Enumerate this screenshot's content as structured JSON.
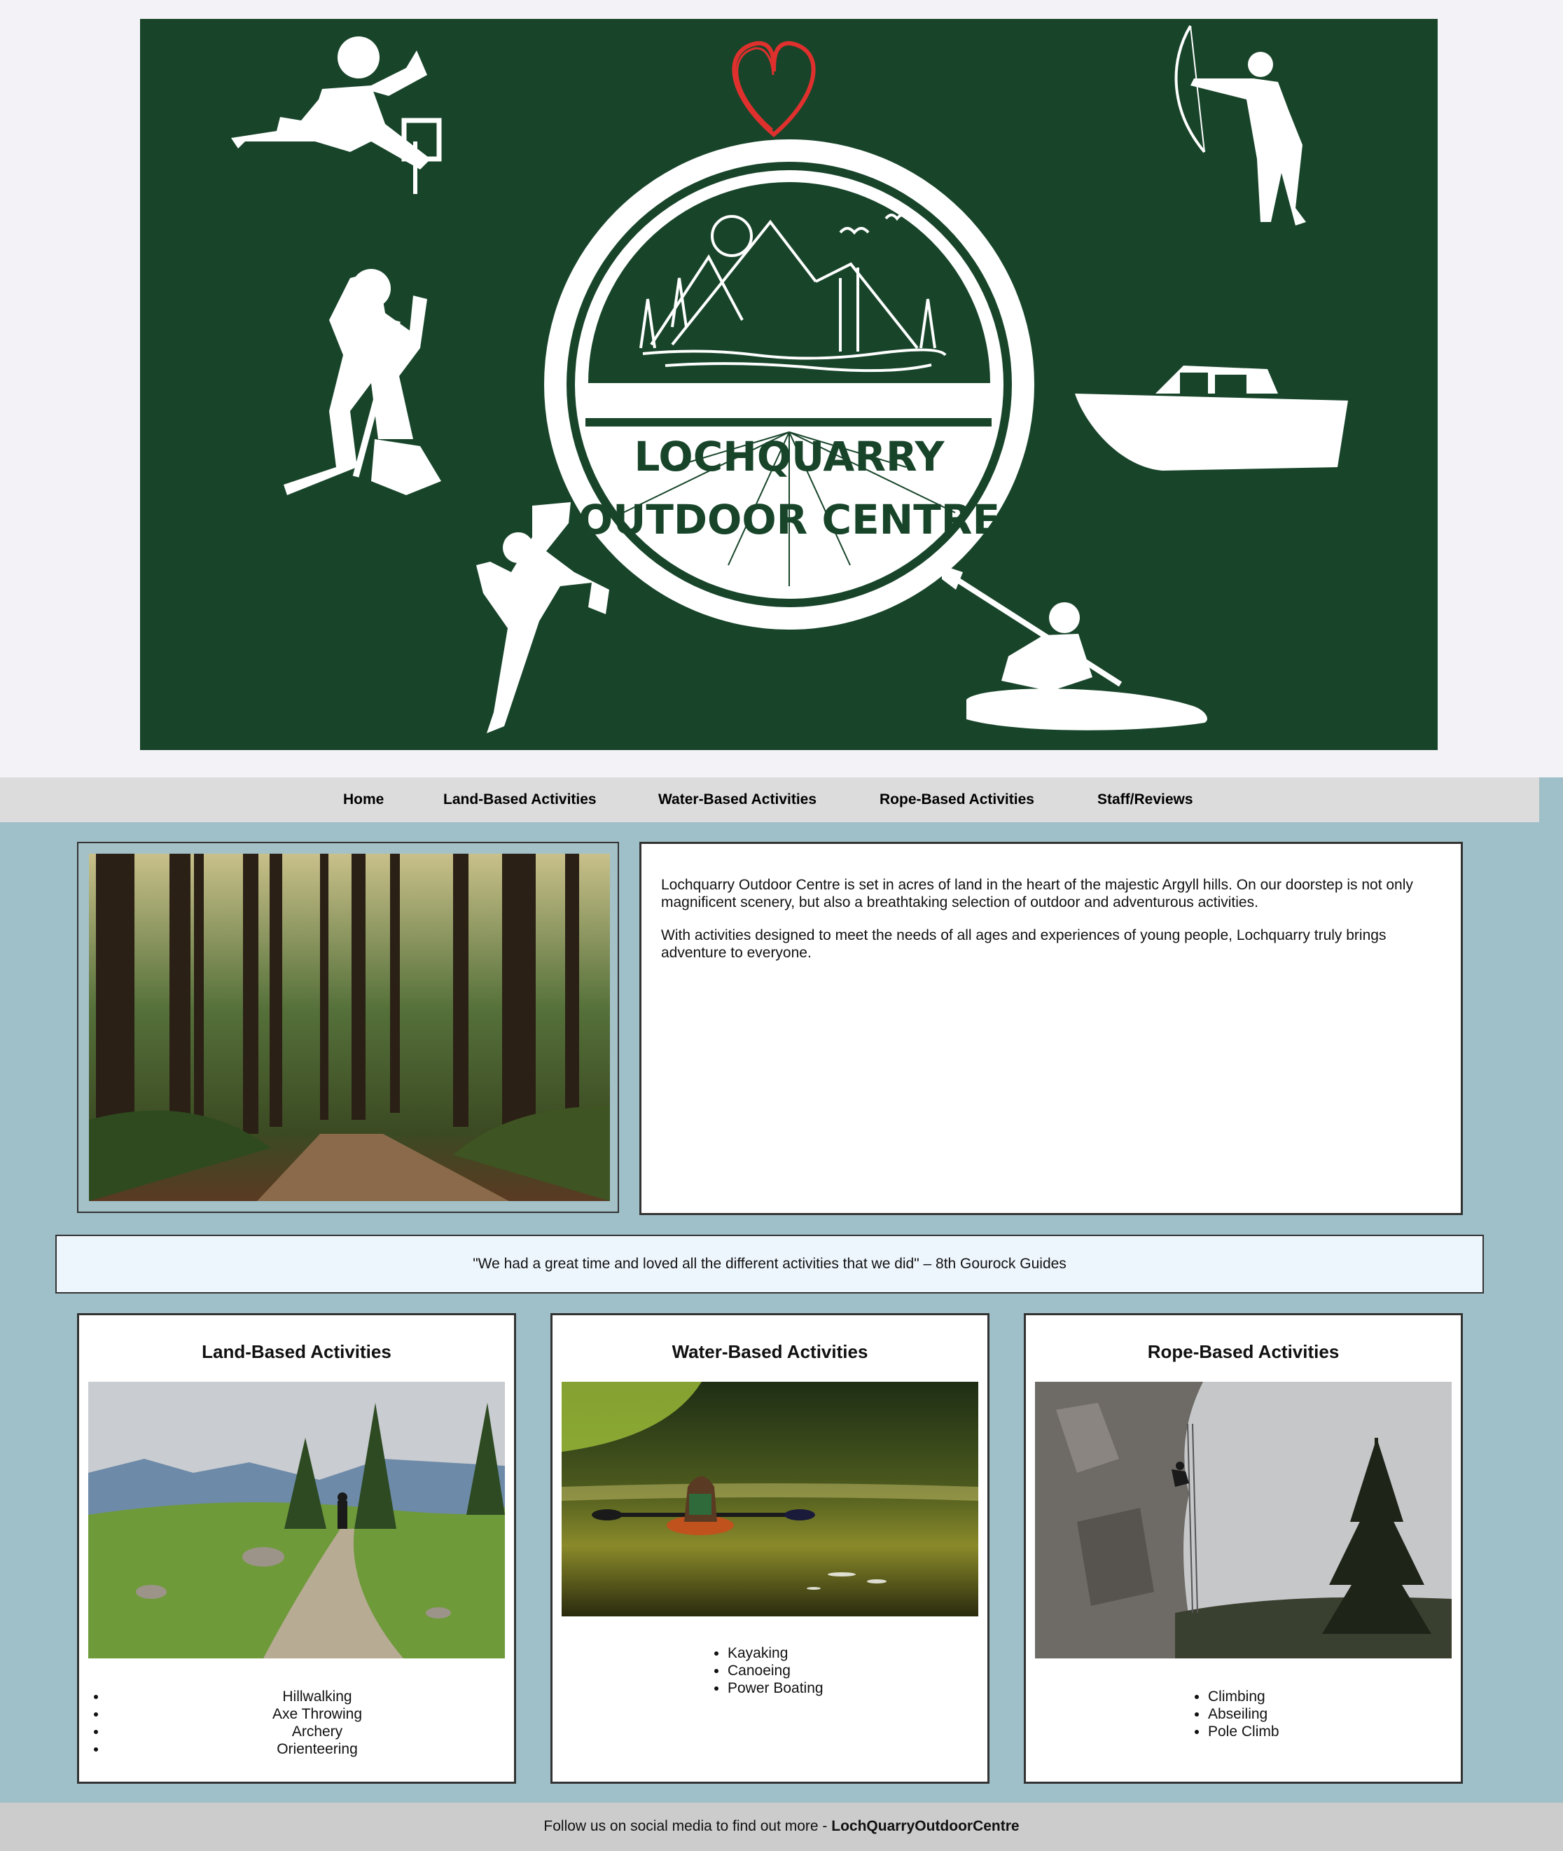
{
  "hero": {
    "logo_line1": "LOCHQUARRY",
    "logo_line2": "OUTDOOR CENTRE",
    "colors": {
      "background": "#18452a",
      "heart": "#e0302e"
    }
  },
  "nav": {
    "items": [
      "Home",
      "Land-Based Activities",
      "Water-Based Activities",
      "Rope-Based Activities",
      "Staff/Reviews"
    ]
  },
  "intro": {
    "paragraph1": "Lochquarry Outdoor Centre is set in acres of land in the heart of the majestic Argyll hills. On our doorstep is not only magnificent scenery, but also a breathtaking selection of outdoor and adventurous activities.",
    "paragraph2": "With activities designed to meet the needs of all ages and experiences of young people, Lochquarry truly brings adventure to everyone."
  },
  "quote": "\"We had a great time and loved all the different activities that we did\" – 8th Gourock Guides",
  "cards": [
    {
      "title": "Land-Based Activities",
      "items": [
        "Hillwalking",
        "Axe Throwing",
        "Archery",
        "Orienteering"
      ]
    },
    {
      "title": "Water-Based Activities",
      "items": [
        "Kayaking",
        "Canoeing",
        "Power Boating"
      ]
    },
    {
      "title": "Rope-Based Activities",
      "items": [
        "Climbing",
        "Abseiling",
        "Pole Climb"
      ]
    }
  ],
  "footer": {
    "text": "Follow us on social media to find out more - ",
    "handle": "LochQuarryOutdoorCentre"
  }
}
